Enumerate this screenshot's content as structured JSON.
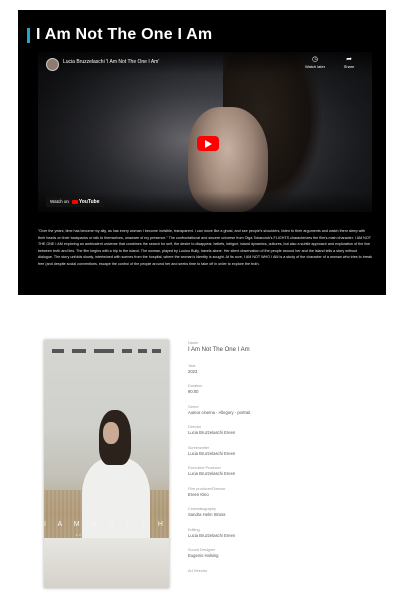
{
  "film": {
    "title": "I Am Not The One I Am"
  },
  "video": {
    "channel_title": "Lucia Bruzzelaschi 'I Am Not The One I Am'",
    "watch_later": "Watch later",
    "share": "Share",
    "watch_on": "Watch on",
    "youtube": "YouTube"
  },
  "description": "\"Over the years, time has become my ally, as has every woman I become invisible, transparent. I can move like a ghost, and see people's shoulders, listen to their arguments and watch them sleep with their heads on their backpacks or talk to themselves, unaware of my presence.\" The confrontational and sincere universe from Olga Tokarczuk's FLIGHTS characterizes the film's main character. I AM NOT THE ONE I AM exploring an ambivalent universe that combines the search for self, the desire to disappear, beliefs, intrigue, island dynamics, cultures, but also a subtle approach and exploration of the line between truth and lies. The film begins with a trip to the island. The woman, played by Loulou Bully, travels alone. Her silent observation of the people around her and the island tells a story without dialogue. The story unfolds slowly, intertwined with scenes from the hospital, where the woman's identity is sought. At its core, I AM NOT WHO I AM is a study of the character of a woman who tries to break free (and despite social conventions, escape the control of the people around her and seeks time to take off in order to explore the truth.",
  "poster": {
    "title": "I A M   N O T   T H E   O N E   I   A M",
    "subtitle": "A FILM BY LUCIA BRUZZELASCHI"
  },
  "info": [
    {
      "label": "Name",
      "value": "I Am Not The One I Am"
    },
    {
      "label": "Year",
      "value": "2023"
    },
    {
      "label": "Duration",
      "value": "90:00"
    },
    {
      "label": "Genre",
      "value": "Auteur cinema - Allegory - portrait"
    },
    {
      "label": "Director",
      "value": "Lucia Bruzzelaschi Ereen"
    },
    {
      "label": "Screenwriter",
      "value": "Lucia Bruzzelaschi Ereen"
    },
    {
      "label": "Executive Producer",
      "value": "Lucia Bruzzelaschi Ereen"
    },
    {
      "label": "Film producer/Director",
      "value": "Ereen Kino"
    },
    {
      "label": "Cinematography",
      "value": "Sandra Helm Struss"
    },
    {
      "label": "Editing",
      "value": "Lucia Bruzzelaschi Ereen"
    },
    {
      "label": "Sound Designer",
      "value": "Eugenio Halsing"
    },
    {
      "label": "Art Director",
      "value": ""
    }
  ],
  "colors": {
    "accent": "#20a6c8",
    "play_button": "#ff0000"
  }
}
